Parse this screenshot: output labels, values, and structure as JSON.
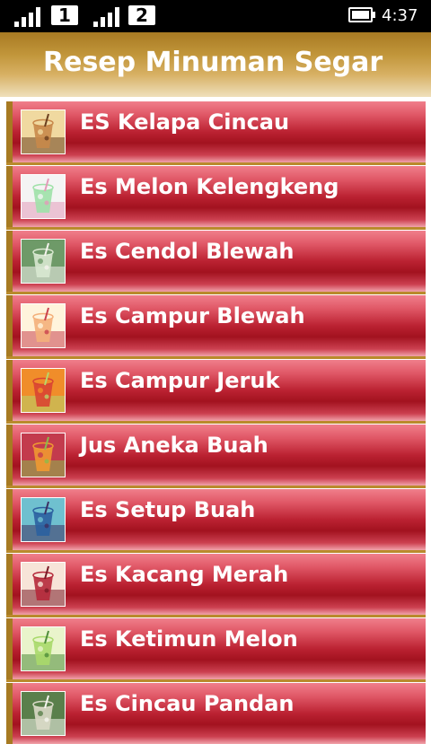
{
  "status_bar": {
    "sim1": "1",
    "sim2": "2",
    "time": "4:37",
    "signal_icon": "signal-bars-icon",
    "battery_icon": "battery-icon"
  },
  "app": {
    "title": "Resep Minuman Segar"
  },
  "colors": {
    "item_gradient_top": "#f07f8b",
    "item_gradient_bottom": "#a2121f",
    "item_accent": "#a77a22",
    "title_bar": "#c2963b"
  },
  "list": {
    "items": [
      {
        "label": "ES Kelapa Cincau",
        "thumb_colors": [
          "#c8884a",
          "#f0d9a0",
          "#6b3f1e"
        ]
      },
      {
        "label": "Es Melon Kelengkeng",
        "thumb_colors": [
          "#9fe1a8",
          "#f4f4f4",
          "#e49ab9"
        ]
      },
      {
        "label": "Es Cendol Blewah",
        "thumb_colors": [
          "#d8e8d0",
          "#6e9a68",
          "#f6f3ee"
        ]
      },
      {
        "label": "Es Campur Blewah",
        "thumb_colors": [
          "#f4b07a",
          "#fff4dc",
          "#c9414e"
        ]
      },
      {
        "label": "Es Campur Jeruk",
        "thumb_colors": [
          "#d94432",
          "#f08d2a",
          "#b7d66b"
        ]
      },
      {
        "label": "Jus Aneka Buah",
        "thumb_colors": [
          "#f09932",
          "#c33b4d",
          "#8bbb4c"
        ]
      },
      {
        "label": "Es Setup Buah",
        "thumb_colors": [
          "#2b61a0",
          "#6fc0cf",
          "#3d2f62"
        ]
      },
      {
        "label": "Es Kacang Merah",
        "thumb_colors": [
          "#b5293b",
          "#f7e4d8",
          "#7a1a26"
        ]
      },
      {
        "label": "Es Ketimun Melon",
        "thumb_colors": [
          "#a8d96a",
          "#e9f4cb",
          "#4f8d3a"
        ]
      },
      {
        "label": "Es Cincau Pandan",
        "thumb_colors": [
          "#d9d9c7",
          "#5a7f4b",
          "#f5f5ef"
        ]
      }
    ]
  }
}
